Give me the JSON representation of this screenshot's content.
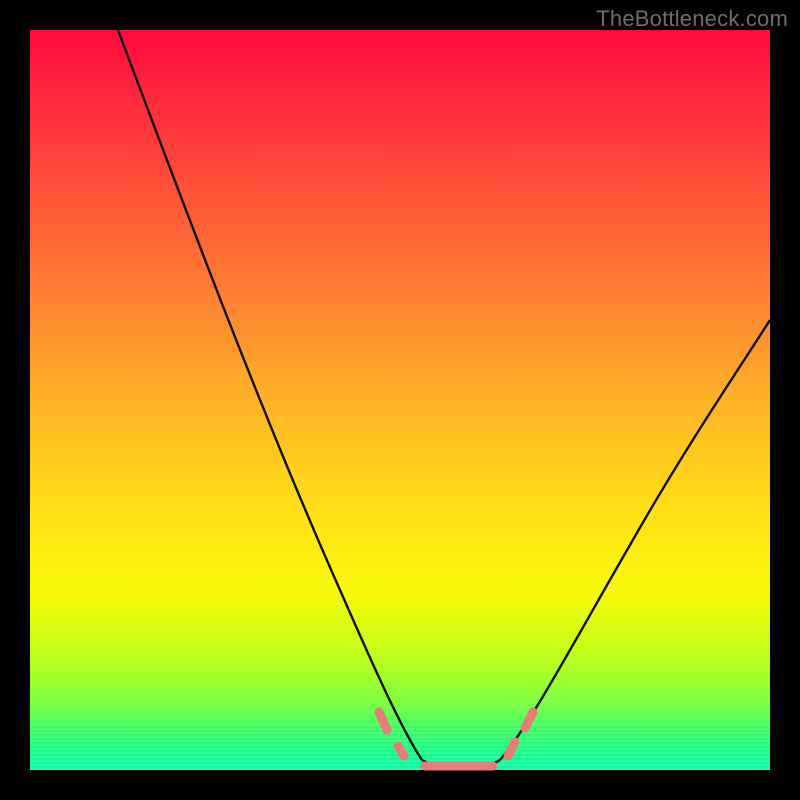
{
  "watermark": "TheBottleneck.com",
  "chart_data": {
    "type": "line",
    "title": "",
    "xlabel": "",
    "ylabel": "",
    "xlim": [
      0,
      100
    ],
    "ylim": [
      0,
      100
    ],
    "grid": false,
    "legend": false,
    "series": [
      {
        "name": "left_curve",
        "x": [
          12,
          20,
          30,
          40,
          47,
          50,
          53
        ],
        "values": [
          100,
          78,
          50,
          24,
          8,
          3,
          1
        ]
      },
      {
        "name": "right_curve",
        "x": [
          63,
          66,
          70,
          80,
          90,
          100
        ],
        "values": [
          1,
          4,
          9,
          24,
          42,
          61
        ]
      },
      {
        "name": "flat_bottom",
        "x": [
          53,
          63
        ],
        "values": [
          0,
          0
        ]
      }
    ],
    "markers": {
      "name": "salmon_dots",
      "color": "#e77d77",
      "points": [
        {
          "x": 47.5,
          "y": 7.5
        },
        {
          "x": 50.0,
          "y": 3.0
        },
        {
          "x": 53.0,
          "y": 0.8
        },
        {
          "x": 56.0,
          "y": 0.3
        },
        {
          "x": 58.0,
          "y": 0.3
        },
        {
          "x": 60.0,
          "y": 0.3
        },
        {
          "x": 63.0,
          "y": 0.8
        },
        {
          "x": 65.5,
          "y": 3.5
        },
        {
          "x": 67.5,
          "y": 7.5
        }
      ]
    },
    "background": {
      "type": "vertical_gradient",
      "stops": [
        {
          "pos": 0.0,
          "color": "#ff0b3e"
        },
        {
          "pos": 0.5,
          "color": "#ffcb1e"
        },
        {
          "pos": 0.78,
          "color": "#f7fa0a"
        },
        {
          "pos": 1.0,
          "color": "#13ffae"
        }
      ]
    }
  }
}
